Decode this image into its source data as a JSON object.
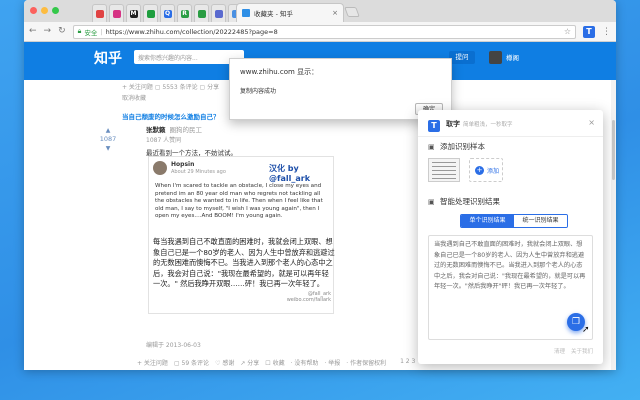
{
  "browser": {
    "tab_title": "收藏夹 - 知乎",
    "tab_close": "×",
    "pinned": [
      {
        "label": "",
        "color": "#e04343"
      },
      {
        "label": "",
        "color": "#d63384"
      },
      {
        "label": "M",
        "color": "#222222"
      },
      {
        "label": "",
        "color": "#1e9e3e"
      },
      {
        "label": "Q",
        "color": "#2b6ee6"
      },
      {
        "label": "R",
        "color": "#2a9d43"
      },
      {
        "label": "",
        "color": "#2a9d43"
      },
      {
        "label": "",
        "color": "#5a6acf"
      },
      {
        "label": "",
        "color": "#4a90e2"
      }
    ],
    "security": "安全",
    "url": "https://www.zhihu.com/collection/20222485?page=8",
    "back_icon": "←",
    "forward_icon": "→",
    "reload_icon": "↻",
    "star_icon": "☆",
    "menu_icon": "⋮",
    "ext_label": "T"
  },
  "zhihu": {
    "logo": "知乎",
    "search_placeholder": "搜索你感兴趣的内容...",
    "ask_button": "提问",
    "username": "樽阁"
  },
  "content": {
    "meta_line1": "+ 关注问题  ▢ 5553 条评论  ▢ 分享",
    "meta_line2": "取消收藏",
    "question": "当自己颓废的时候怎么激励自己？",
    "vote_up": "▲",
    "vote_count": "1087",
    "vote_down": "▼",
    "author_name": "张默籁",
    "author_bio": "圈狗的民工",
    "agree_count": "1087 人赞同",
    "intro": "最近看到一个方法，不妨试试。",
    "tweet": {
      "name": "Hopsin",
      "time": "About 29 Minutes ago",
      "brand": "汉化 by @fall_ark",
      "en_text": "When I'm scared to tackle an obstacle, I close my eyes and pretend im an 80 year old man who regrets not tackling all the obstacles he wanted to in life. Then when I feel like that old man, I say to myself, \"I wish I was young again\", then I open my eyes....And BOOM! I'm young again.",
      "cn_text": "每当我遇到自己不敢直面的困难时，我就会闭上双眼、想象自己已是一个80岁的老人、因为人生中曾放弃和逃避过的无数困难而懊悔不已。当我进入到那个老人的心态中之后，我会对自己说：\"我现在最希望的，就是可以再年轻一次。\" 然后我睁开双眼……砰！我已再一次年轻了。",
      "watermark": "@fall_ark weibo.com/fallark"
    },
    "edited": "编辑于 2013-06-03",
    "actions": [
      "+ 关注问题",
      "▢ 59 条评论",
      "♡ 感谢",
      "↗ 分享",
      "☐ 收藏",
      "· 没有帮助",
      "· 举报",
      "· 作者保留权利"
    ],
    "page_label": "1 2 3"
  },
  "alert": {
    "title": "www.zhihu.com 显示：",
    "message": "复制内容成功",
    "ok": "确定"
  },
  "panel": {
    "logo": "T",
    "name": "取字",
    "slogan": "简单粗浅，一秒取字",
    "close": "×",
    "section1_icon": "▣",
    "section1_title": "添加识别样本",
    "add_label": "添加",
    "add_icon": "+",
    "section2_icon": "▣",
    "section2_title": "智能处理识别结果",
    "seg_on": "单个识别结果",
    "seg_off": "统一识别结果",
    "result_text": "当我遇到自己不敢直面的困难时，我就会闭上双眼、想象自己已是一个80岁的老人、因为人生中曾放弃和逃避过的无数困难而懊悔不已。当我进入到那个老人的心态中之后，我会对自己说：\"我现在最希望的，就是可以再年轻一次。\"然后我睁开\"砰！我已再一次年轻了。",
    "copy_icon": "❐",
    "footer": [
      "清理",
      "关于我们"
    ]
  }
}
